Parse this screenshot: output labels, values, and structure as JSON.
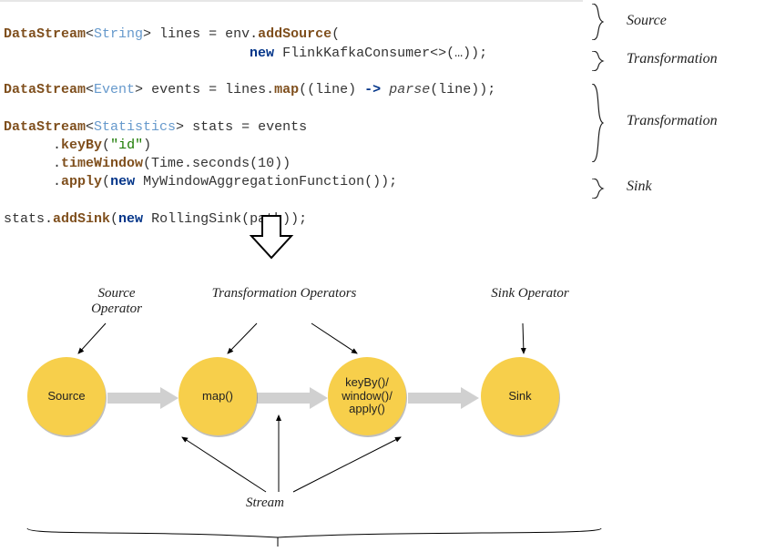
{
  "code": {
    "line1": {
      "type": "DataStream",
      "gen": "String",
      "var": "lines",
      "eq": "= env.",
      "m": "addSource",
      "open": "("
    },
    "line2": {
      "kw": "new",
      "cls": "FlinkKafkaConsumer<>",
      "args": "(…));"
    },
    "line3": {
      "type": "DataStream",
      "gen": "Event",
      "var": "events",
      "eq": "= lines.",
      "m": "map",
      "open": "((line)",
      "arrow": "->",
      "call": "parse",
      "tail": "(line));"
    },
    "line4": {
      "type": "DataStream",
      "gen": "Statistics",
      "var": "stats",
      "eq": "= events"
    },
    "line5": {
      "dot": ".",
      "m": "keyBy",
      "args": "(",
      "str": "\"id\"",
      "end": ")"
    },
    "line6": {
      "dot": ".",
      "m": "timeWindow",
      "args": "(Time.seconds(10))"
    },
    "line7": {
      "dot": ".",
      "m": "apply",
      "open": "(",
      "kw": "new",
      "cls": "MyWindowAggregationFunction());"
    },
    "line8": {
      "obj": "stats.",
      "m": "addSink",
      "open": "(",
      "kw": "new",
      "cls": "RollingSink(path));"
    }
  },
  "annotations": {
    "source": "Source",
    "trans1": "Transformation",
    "trans2": "Transformation",
    "sink": "Sink"
  },
  "diagram": {
    "nodes": {
      "source": "Source",
      "map": "map()",
      "keyby": "keyBy()/\nwindow()/\napply()",
      "sink": "Sink"
    },
    "labels": {
      "srcOp": "Source\nOperator",
      "transOp": "Transformation\nOperators",
      "sinkOp": "Sink\nOperator",
      "stream": "Stream"
    }
  }
}
